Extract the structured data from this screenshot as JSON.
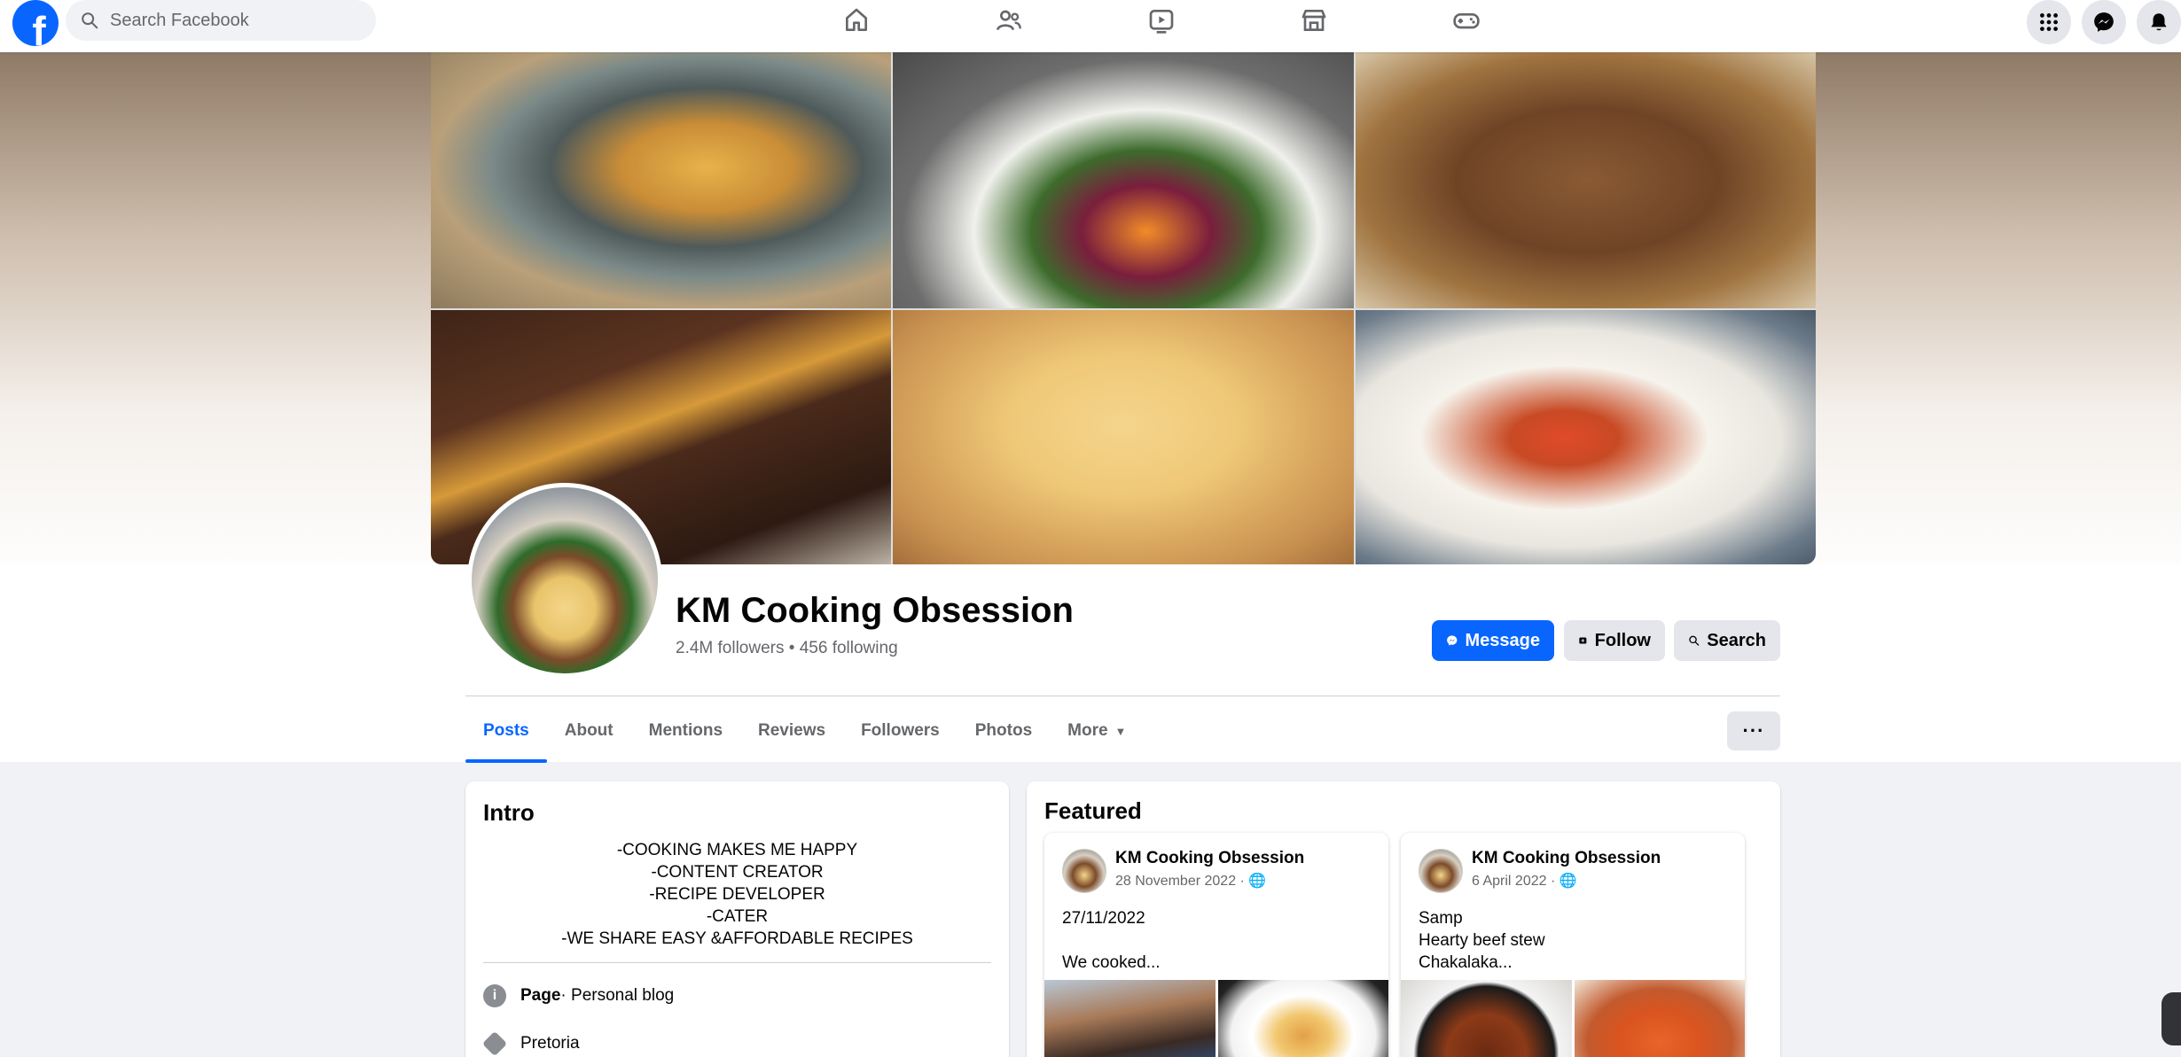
{
  "search": {
    "placeholder": "Search Facebook"
  },
  "nav": [
    {
      "name": "home-icon"
    },
    {
      "name": "friends-icon"
    },
    {
      "name": "video-icon"
    },
    {
      "name": "marketplace-icon"
    },
    {
      "name": "gaming-icon"
    }
  ],
  "top_right": [
    "menu-grid-icon",
    "messenger-icon",
    "notifications-icon"
  ],
  "page": {
    "name": "KM Cooking Obsession",
    "followers": "2.4M followers",
    "separator": " • ",
    "following": "456 following"
  },
  "actions": {
    "message": "Message",
    "follow": "Follow",
    "search": "Search"
  },
  "tabs": [
    {
      "label": "Posts",
      "active": true
    },
    {
      "label": "About"
    },
    {
      "label": "Mentions"
    },
    {
      "label": "Reviews"
    },
    {
      "label": "Followers"
    },
    {
      "label": "Photos"
    },
    {
      "label": "More"
    }
  ],
  "more_menu": "···",
  "intro": {
    "title": "Intro",
    "bio": [
      "-COOKING MAKES ME HAPPY",
      "-CONTENT CREATOR",
      "-RECIPE DEVELOPER",
      "-CATER",
      "-WE SHARE EASY &AFFORDABLE RECIPES"
    ],
    "category_label": "Page",
    "category_value": " · Personal blog",
    "location": "Pretoria"
  },
  "featured": {
    "title": "Featured",
    "posts": [
      {
        "author": "KM Cooking Obsession",
        "date": "28 November 2022 · ",
        "lines": [
          "27/11/2022",
          "",
          "We cooked..."
        ]
      },
      {
        "author": "KM Cooking Obsession",
        "date": "6 April 2022 · ",
        "lines": [
          "Samp",
          "Hearty beef stew",
          "Chakalaka..."
        ]
      }
    ]
  },
  "colors": {
    "brand": "#0866ff",
    "secondary_btn": "#e4e6eb",
    "muted_text": "#65676b"
  }
}
